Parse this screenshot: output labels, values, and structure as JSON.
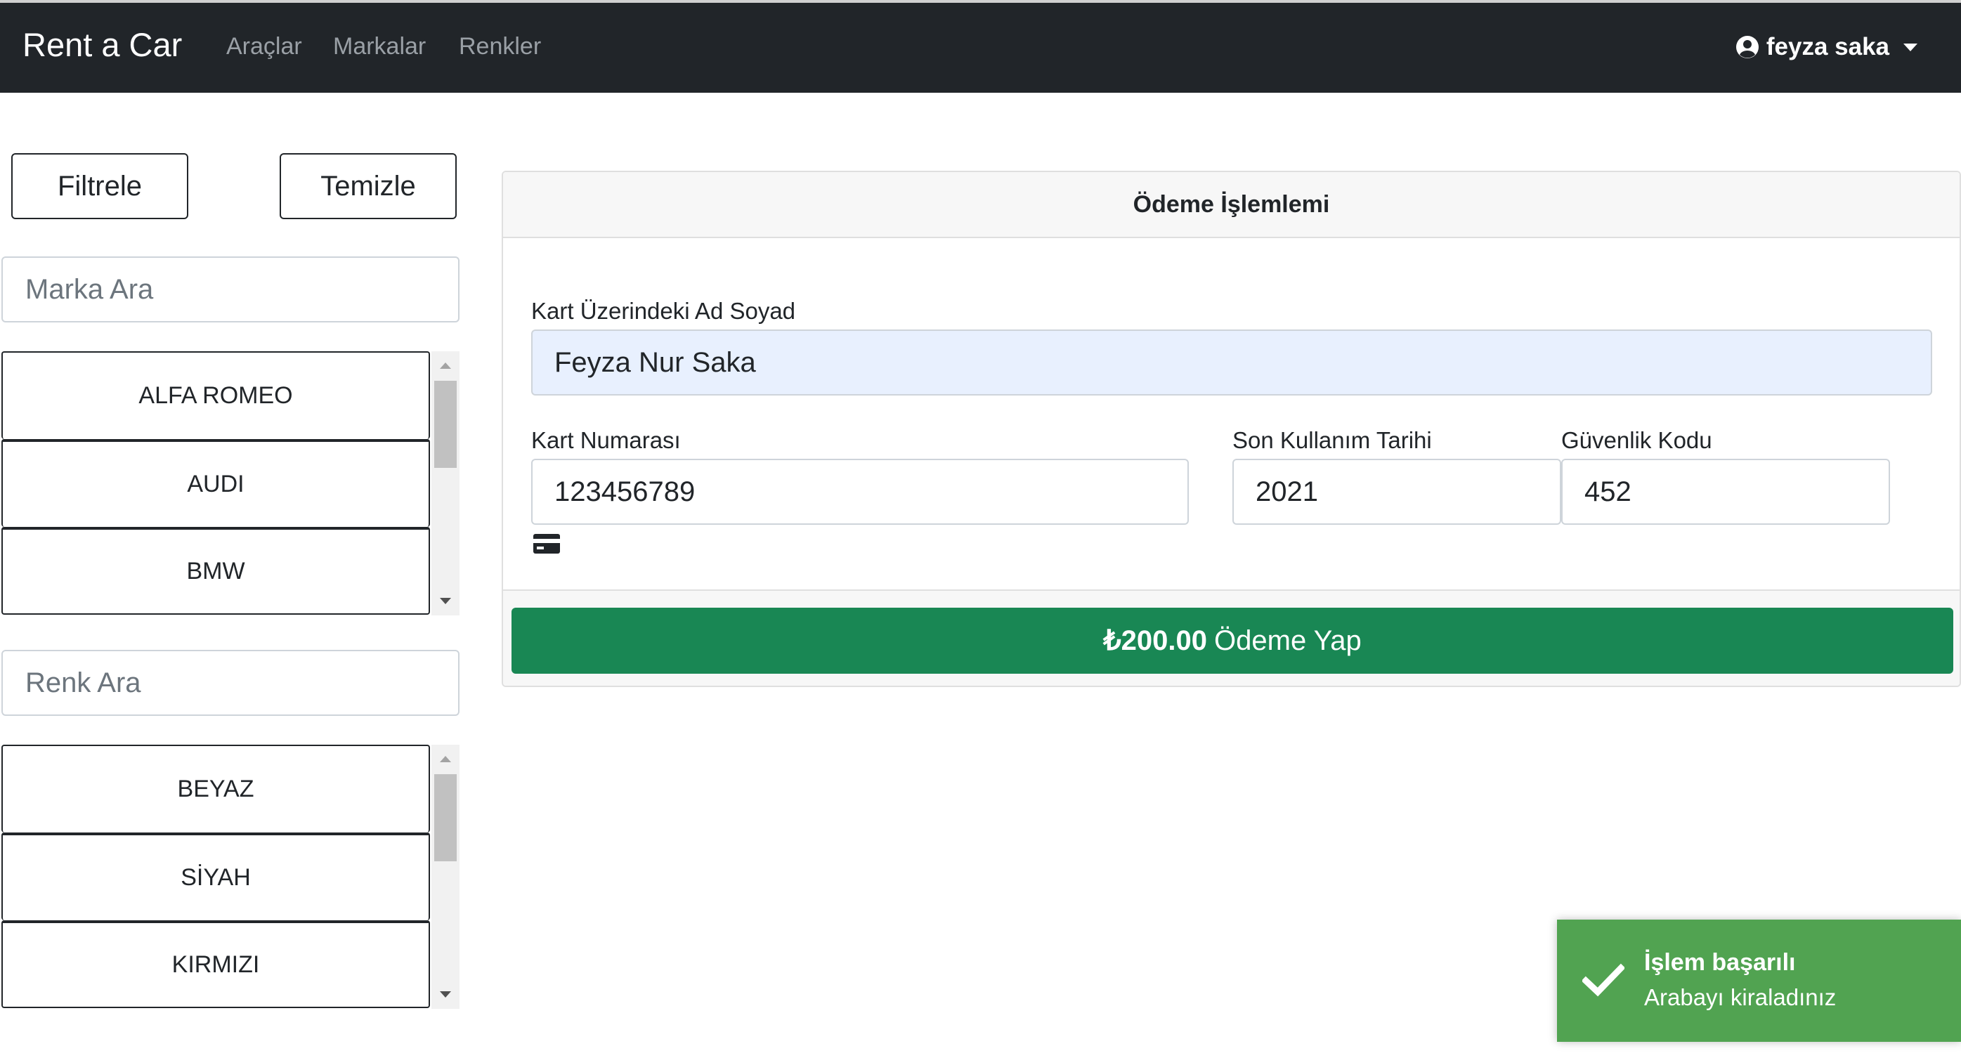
{
  "navbar": {
    "brand": "Rent a Car",
    "links": [
      "Araçlar",
      "Markalar",
      "Renkler"
    ],
    "user_name": "feyza saka"
  },
  "sidebar": {
    "filter_label": "Filtrele",
    "clear_label": "Temizle",
    "brand_search_placeholder": "Marka Ara",
    "brands": [
      "ALFA ROMEO",
      "AUDI",
      "BMW"
    ],
    "color_search_placeholder": "Renk Ara",
    "colors": [
      "BEYAZ",
      "SİYAH",
      "KIRMIZI"
    ]
  },
  "payment": {
    "title": "Ödeme İşlemlemi",
    "name_label": "Kart Üzerindeki Ad Soyad",
    "name_value": "Feyza Nur Saka",
    "number_label": "Kart Numarası",
    "number_value": "123456789",
    "expiry_label": "Son Kullanım Tarihi",
    "expiry_value": "2021",
    "cvc_label": "Güvenlik Kodu",
    "cvc_value": "452",
    "amount": "₺200.00",
    "pay_label": "Ödeme Yap"
  },
  "toast": {
    "title": "İşlem başarılı",
    "message": "Arabayı kiraladınız",
    "color": "#51a351"
  },
  "colors": {
    "navbar": "#212529",
    "pay_button": "#198754",
    "autofill": "#e8f0fe"
  }
}
